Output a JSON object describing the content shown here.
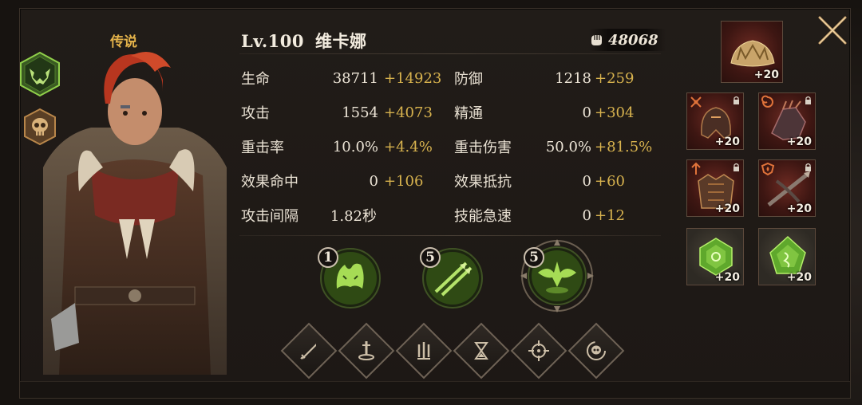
{
  "hero": {
    "rarity": "传说",
    "level": "Lv.100",
    "name": "维卡娜",
    "power": "48068"
  },
  "stats": [
    {
      "label": "生命",
      "base": "38711",
      "bonus": "+14923"
    },
    {
      "label": "防御",
      "base": "1218",
      "bonus": "+259"
    },
    {
      "label": "攻击",
      "base": "1554",
      "bonus": "+4073"
    },
    {
      "label": "精通",
      "base": "0",
      "bonus": "+304"
    },
    {
      "label": "重击率",
      "base": "10.0%",
      "bonus": "+4.4%"
    },
    {
      "label": "重击伤害",
      "base": "50.0%",
      "bonus": "+81.5%"
    },
    {
      "label": "效果命中",
      "base": "0",
      "bonus": "+106"
    },
    {
      "label": "效果抵抗",
      "base": "0",
      "bonus": "+60"
    },
    {
      "label": "攻击间隔",
      "base": "1.82秒",
      "bonus": ""
    },
    {
      "label": "技能急速",
      "base": "0",
      "bonus": "+12"
    }
  ],
  "skills": [
    {
      "rank": "1",
      "icon": "beast-spirit-icon"
    },
    {
      "rank": "5",
      "icon": "twin-arrows-icon"
    },
    {
      "rank": "5",
      "icon": "bat-wing-icon"
    }
  ],
  "stat_filters": [
    "sword-icon",
    "sword-in-stone-icon",
    "triple-blade-icon",
    "hourglass-icon",
    "crosshair-icon",
    "skull-swirl-icon"
  ],
  "equipment": [
    {
      "slot": "crown",
      "level": "+20"
    },
    {
      "slot": "helmet",
      "level": "+20"
    },
    {
      "slot": "gloves",
      "level": "+20"
    },
    {
      "slot": "armor",
      "level": "+20"
    },
    {
      "slot": "weapon",
      "level": "+20"
    },
    {
      "slot": "rune-1",
      "level": "+20"
    },
    {
      "slot": "rune-2",
      "level": "+20"
    }
  ],
  "colors": {
    "accent_gold": "#e3b24a",
    "bonus": "#d7b24e",
    "equip_red": "#6c2a22",
    "skill_green": "#7cc23a"
  }
}
